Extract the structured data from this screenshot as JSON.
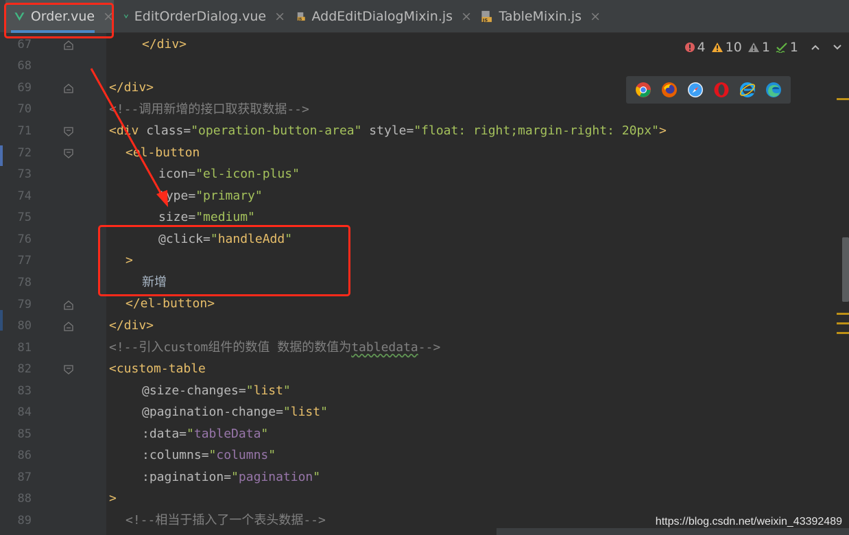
{
  "tabs": [
    {
      "label": "Order.vue",
      "type": "vue",
      "active": true
    },
    {
      "label": "EditOrderDialog.vue",
      "type": "vue",
      "active": false
    },
    {
      "label": "AddEditDialogMixin.js",
      "type": "js",
      "active": false
    },
    {
      "label": "TableMixin.js",
      "type": "js",
      "active": false
    }
  ],
  "tab_close_glyph": "×",
  "inspections": {
    "errors": "4",
    "warnings": "10",
    "weak_warnings": "1",
    "typos": "1",
    "nav_up": "⌃",
    "nav_down": "⌄"
  },
  "line_numbers": [
    "67",
    "68",
    "69",
    "70",
    "71",
    "72",
    "73",
    "74",
    "75",
    "76",
    "77",
    "78",
    "79",
    "80",
    "81",
    "82",
    "83",
    "84",
    "85",
    "86",
    "87",
    "88",
    "89"
  ],
  "code": {
    "l67_close": "</div>",
    "l69_close": "</div>",
    "l70_comment": "<!--调用新增的接口取获取数据-->",
    "l71_open": "<div",
    "l71_attr1": " class=",
    "l71_val1": "\"operation-button-area\"",
    "l71_attr2": " style=",
    "l71_val2": "\"float: right;margin-right: 20px\"",
    "l71_end": ">",
    "l72_open": "<el-button",
    "l73_attr": "icon=",
    "l73_val": "\"el-icon-plus\"",
    "l74_attr": "type=",
    "l74_val": "\"primary\"",
    "l75_attr": "size=",
    "l75_val": "\"medium\"",
    "l76_attr": "@click=",
    "l76_q1": "\"",
    "l76_val": "handleAdd",
    "l76_q2": "\"",
    "l77_end": ">",
    "l78_text": "新增",
    "l79_close": "</el-button>",
    "l80_close": "</div>",
    "l81_comment_a": "<!--引入custom组件的数值 数据的数值为",
    "l81_comment_b": "tabledata",
    "l81_comment_c": "-->",
    "l82_open": "<custom-table",
    "l83_attr": "@size-changes=",
    "l83_q1": "\"",
    "l83_val": "list",
    "l83_q2": "\"",
    "l84_attr": "@pagination-change=",
    "l84_q1": "\"",
    "l84_val": "list",
    "l84_q2": "\"",
    "l85_attr": ":data=",
    "l85_q1": "\"",
    "l85_val": "tableData",
    "l85_q2": "\"",
    "l86_attr": ":columns=",
    "l86_q1": "\"",
    "l86_val": "columns",
    "l86_q2": "\"",
    "l87_attr": ":pagination=",
    "l87_q1": "\"",
    "l87_val": "pagination",
    "l87_q2": "\"",
    "l88_end": ">",
    "l89_comment": "<!--相当于插入了一个表头数据-->"
  },
  "browsers": [
    "chrome-icon",
    "firefox-icon",
    "safari-icon",
    "opera-icon",
    "ie-icon",
    "edge-icon"
  ],
  "watermark": "https://blog.csdn.net/weixin_43392489",
  "colors": {
    "editor_bg": "#2b2b2b",
    "gutter_bg": "#313335",
    "tag": "#e8bf6a",
    "string": "#a5c25c",
    "comment": "#808080",
    "annotation": "#ff2a1a"
  }
}
